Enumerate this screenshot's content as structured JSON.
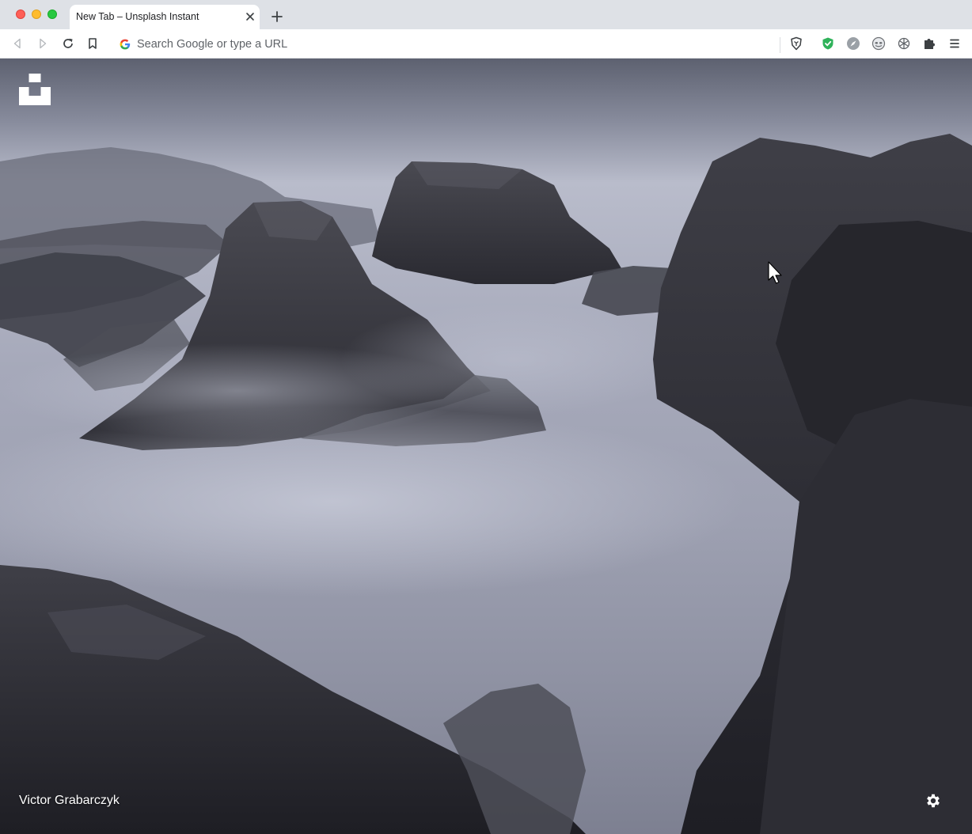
{
  "window": {
    "traffic_lights": {
      "close": "#fe5f57",
      "minimize": "#febc2e",
      "maximize": "#28c840"
    }
  },
  "tab": {
    "title": "New Tab – Unsplash Instant",
    "close_icon": "close-icon"
  },
  "new_tab_icon": "plus-icon",
  "toolbar": {
    "back_icon": "back-arrow-icon",
    "forward_icon": "forward-arrow-icon",
    "reload_icon": "reload-icon",
    "bookmark_icon": "bookmark-icon",
    "omnibox": {
      "placeholder": "Search Google or type a URL",
      "value": "",
      "engine_icon": "google-g-icon"
    },
    "extensions": [
      {
        "icon": "brave-shield-icon",
        "color": "#5f6368"
      },
      {
        "icon": "green-shield-icon",
        "color": "#2fb25a"
      },
      {
        "icon": "compass-icon",
        "color": "#9aa0a6"
      },
      {
        "icon": "mask-icon",
        "color": "#6e7175"
      },
      {
        "icon": "openai-knot-icon",
        "color": "#5f6368"
      },
      {
        "icon": "puzzle-icon",
        "color": "#5f6368"
      }
    ],
    "menu_icon": "menu-icon"
  },
  "page": {
    "logo_icon": "unsplash-logo-icon",
    "photo_credit": "Victor Grabarczyk",
    "settings_icon": "gear-icon",
    "accent_color": "#ffffff"
  }
}
